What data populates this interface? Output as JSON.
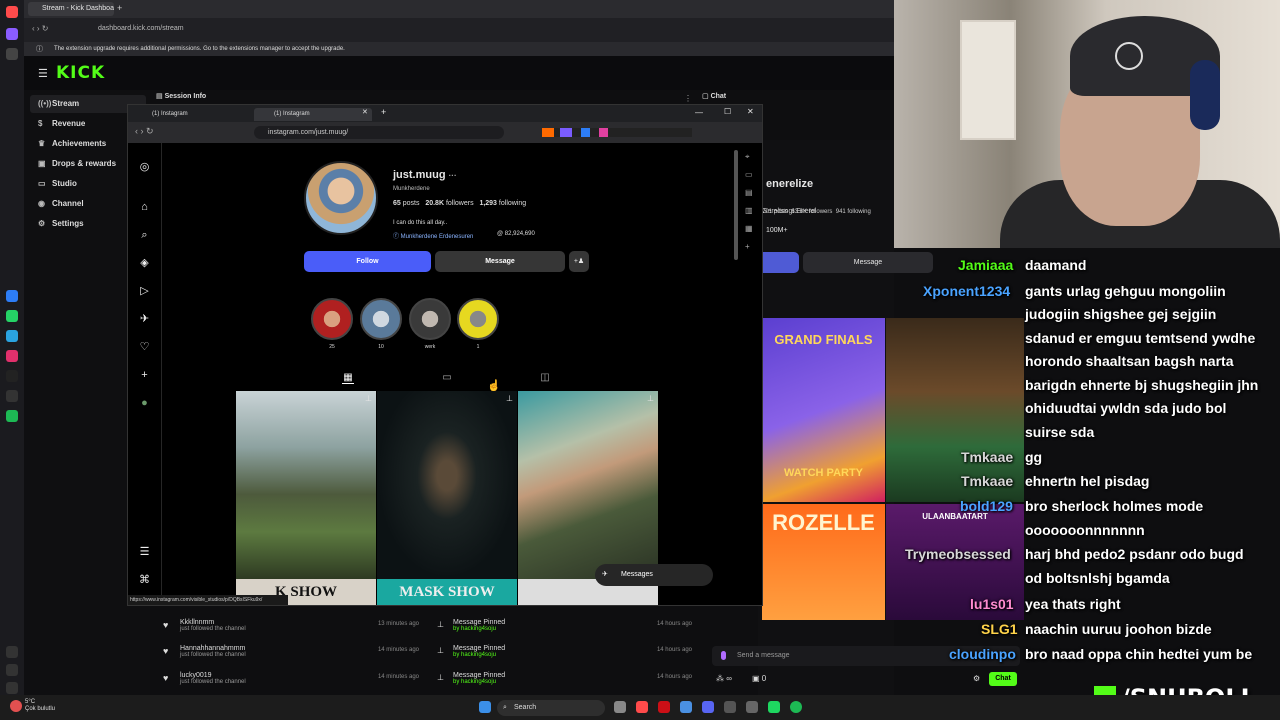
{
  "browser": {
    "tab_title": "Stream - Kick Dashboard",
    "url": "dashboard.kick.com/stream",
    "extension_warning": "The extension upgrade requires additional permissions. Go to the extensions manager to accept the upgrade."
  },
  "kick": {
    "nav": [
      {
        "label": "Stream",
        "icon": "broadcast-icon"
      },
      {
        "label": "Revenue",
        "icon": "dollar-icon"
      },
      {
        "label": "Achievements",
        "icon": "trophy-icon"
      },
      {
        "label": "Drops & rewards",
        "icon": "gift-icon"
      },
      {
        "label": "Studio",
        "icon": "camera-icon"
      },
      {
        "label": "Channel",
        "icon": "user-icon"
      },
      {
        "label": "Settings",
        "icon": "gear-icon"
      }
    ],
    "session_info_label": "Session Info",
    "chat_label": "Chat",
    "followers": [
      {
        "name": "Kkkllnnmm",
        "sub": "just followed the channel",
        "time": "13 minutes ago"
      },
      {
        "name": "Hannahhannahmmm",
        "sub": "just followed the channel",
        "time": "14 minutes ago"
      },
      {
        "name": "lucky0019",
        "sub": "just followed the channel",
        "time": "14 minutes ago"
      }
    ],
    "pinned": [
      {
        "title": "Message Pinned",
        "by": "by hacking4soju",
        "time": "14 hours ago"
      },
      {
        "title": "Message Pinned",
        "by": "by hacking4soju",
        "time": "14 hours ago"
      },
      {
        "title": "Message Pinned",
        "by": "by hacking4soju",
        "time": "14 hours ago"
      }
    ],
    "send_placeholder": "Send a message",
    "chat_button": "Chat",
    "viewer_count": "0"
  },
  "instagram": {
    "tabs": [
      "(1) Instagram",
      "(1) Instagram"
    ],
    "url": "instagram.com/just.muug/",
    "username": "just.muug",
    "full_name": "Munkherdene",
    "posts": "65",
    "posts_label": "posts",
    "followers": "20.8K",
    "followers_label": "followers",
    "following": "1,293",
    "following_label": "following",
    "bio": "I can do this all day..",
    "link_name": "Munkherdene Erdenesuren",
    "link_count": "82,924,690",
    "follow_label": "Follow",
    "message_label": "Message",
    "highlights": [
      "25",
      "10",
      "werk",
      "1"
    ],
    "messages_label": "Messages",
    "status_url": "https://www.instagram.com/visible_studios/p/DQBsISFku9x/",
    "post_texts": [
      "K SHOW",
      "MASK SHOW"
    ]
  },
  "second_profile": {
    "name": "enerelize",
    "full_name": "Gereltsogt Enerel",
    "posts": "201 posts",
    "followers": "63.6K followers",
    "following": "941 following",
    "extra": "100M+",
    "message_label": "Message",
    "thumb_texts": [
      "GRAND FINALS",
      "WATCH PARTY",
      "ROZELLE",
      "ULAANBAATART"
    ]
  },
  "overlay_chat": {
    "users": [
      {
        "name": "Jamiaaa",
        "color": "#53fc18"
      },
      {
        "name": "Xponent1234",
        "color": "#4aa3ff"
      },
      {
        "name": "Tmkaae",
        "color": "#d8d8d8"
      },
      {
        "name": "Tmkaae",
        "color": "#d8d8d8"
      },
      {
        "name": "bold129",
        "color": "#4aa3ff"
      },
      {
        "name": "Trymeobsessed",
        "color": "#d8d8d8"
      },
      {
        "name": "lu1s01",
        "color": "#ff8bd0"
      },
      {
        "name": "SLG1",
        "color": "#ffd34a"
      },
      {
        "name": "cloudinpo",
        "color": "#4aa3ff"
      }
    ],
    "messages": [
      "daamand",
      "gants urlag gehguu mongoliin",
      "judogiin shigshee gej sejgiin",
      "sdanud er emguu temtsend ywdhe",
      "horondo shaaltsan bagsh narta",
      "barigdn ehnerte bj shugshegiin jhn",
      "ohiduudtai ywldn sda judo bol",
      "suirse sda",
      "gg",
      "ehnertn hel pisdag",
      "bro sherlock holmes mode",
      "ooooooonnnnnnn",
      "harj bhd pedo2 psdanr odo bugd",
      "od boltsnlshj bgamda",
      "yea thats right",
      "naachin uuruu joohon bizde",
      "bro naad oppa chin hedtei yum be"
    ],
    "brand": "/SNUBOLI"
  },
  "taskbar": {
    "search_label": "Search",
    "weather_temp": "5°C",
    "weather_desc": "Çok bulutlu"
  }
}
